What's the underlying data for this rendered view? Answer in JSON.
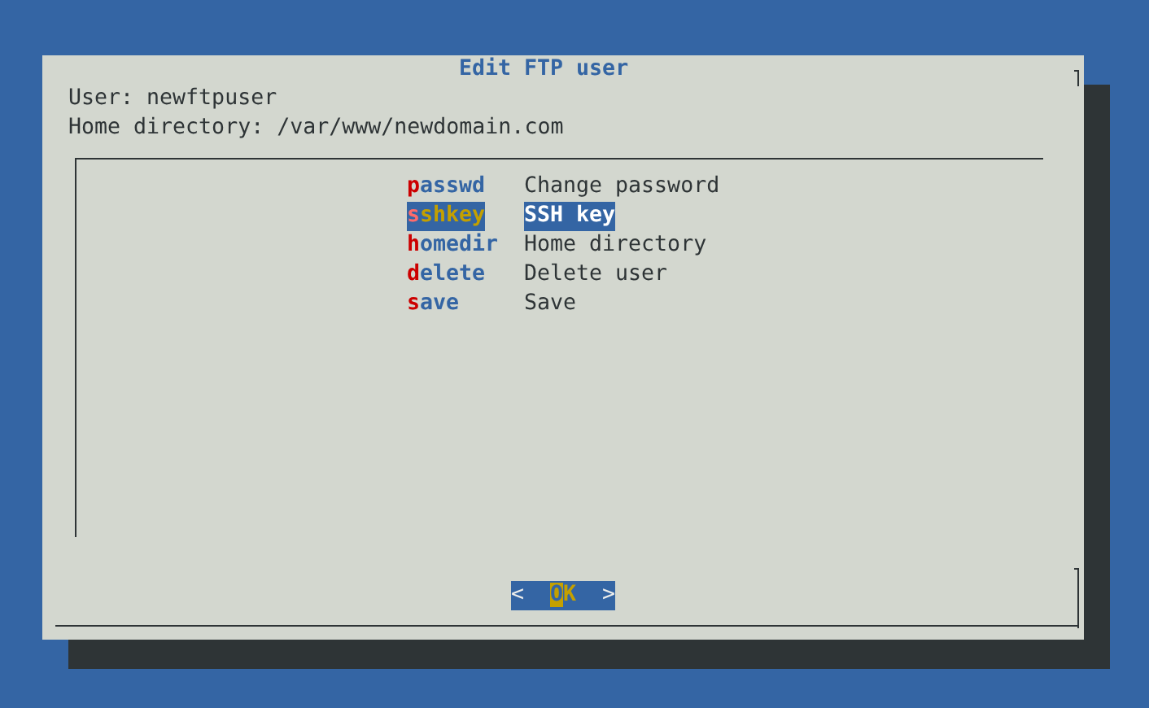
{
  "dialog": {
    "title": "Edit FTP user",
    "info_lines": [
      "User: newftpuser",
      "Home directory: /var/www/newdomain.com"
    ],
    "menu_items": [
      {
        "tag": "passwd",
        "description": "Change password",
        "selected": false
      },
      {
        "tag": "sshkey",
        "description": "SSH key",
        "selected": true
      },
      {
        "tag": "homedir",
        "description": "Home directory",
        "selected": false
      },
      {
        "tag": "delete",
        "description": "Delete user",
        "selected": false
      },
      {
        "tag": "save",
        "description": "Save",
        "selected": false
      }
    ],
    "button": {
      "left_mark": "<",
      "label": "OK",
      "right_mark": ">",
      "selected": true
    }
  }
}
